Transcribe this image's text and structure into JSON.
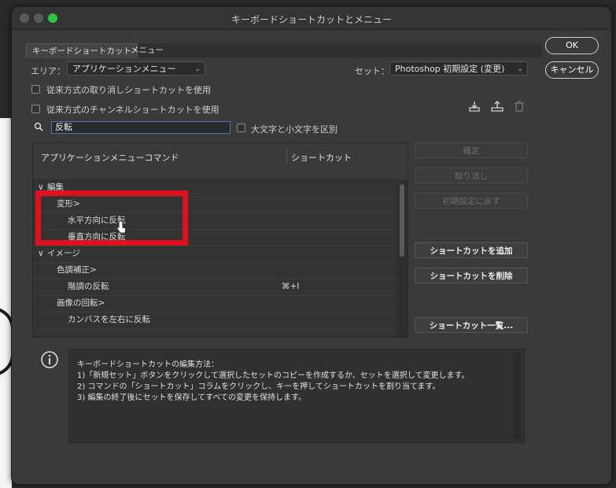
{
  "window": {
    "title": "キーボードショートカットとメニュー",
    "traffic_colors": [
      "#5a5a5a",
      "#5a5a5a",
      "#2fc441"
    ]
  },
  "tabs": [
    {
      "label": "キーボードショートカット",
      "active": true
    },
    {
      "label": "メニュー",
      "active": false
    }
  ],
  "area": {
    "label": "エリア：",
    "value": "アプリケーションメニュー"
  },
  "set": {
    "label": "セット：",
    "value": "Photoshop 初期設定 (変更)"
  },
  "checkboxes": [
    {
      "label": "従来方式の取り消しショートカットを使用",
      "checked": false
    },
    {
      "label": "従来方式のチャンネルショートカットを使用",
      "checked": false
    }
  ],
  "search": {
    "value": "反転",
    "case_label": "大文字と小文字を区別"
  },
  "table": {
    "col_command": "アプリケーションメニューコマンド",
    "col_shortcut": "ショートカット",
    "rows": [
      {
        "label": "編集",
        "shortcut": ""
      },
      {
        "label": "変形>",
        "shortcut": ""
      },
      {
        "label": "水平方向に反転",
        "shortcut": ""
      },
      {
        "label": "垂直方向に反転",
        "shortcut": ""
      },
      {
        "label": "イメージ",
        "shortcut": ""
      },
      {
        "label": "色調補正>",
        "shortcut": ""
      },
      {
        "label": "階調の反転",
        "shortcut": "⌘+I"
      },
      {
        "label": "画像の回転>",
        "shortcut": ""
      },
      {
        "label": "カンバスを左右に反転",
        "shortcut": ""
      }
    ]
  },
  "right_buttons": {
    "accept": "確定",
    "undo": "取り消し",
    "reset": "初期設定に戻す",
    "add": "ショートカットを追加",
    "delete": "ショートカットを削除",
    "summarize": "ショートカット一覧..."
  },
  "dialog_buttons": {
    "ok": "OK",
    "cancel": "キャンセル"
  },
  "info": {
    "heading": "キーボードショートカットの編集方法：",
    "steps": [
      "1)「新規セット」ボタンをクリックして選択したセットのコピーを作成するか、セットを選択して変更します。",
      "2) コマンドの「ショートカット」コラムをクリックし、キーを押してショートカットを割り当てます。",
      "3) 編集の終了後にセットを保存してすべての変更を保持します。"
    ]
  },
  "colors": {
    "highlight": "#e0101e",
    "accent": "#4d78b8"
  }
}
